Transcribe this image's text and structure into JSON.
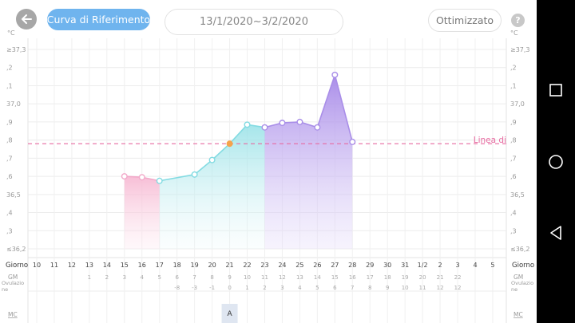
{
  "header": {
    "back_icon": "arrow-left-icon",
    "curve_button_label": "Curva di Riferimento",
    "date_range": "13/1/2020~3/2/2020",
    "optimized_label": "Ottimizzato",
    "help_label": "?"
  },
  "axes": {
    "unit_left": "°C",
    "unit_right": "°C",
    "y_labels": [
      "≥37,3",
      ",2",
      ",1",
      "37,0",
      ",9",
      ",8",
      ",7",
      ",6",
      "36,5",
      ",4",
      ",3",
      "≤36,2"
    ]
  },
  "reference_line_label": "Linea di",
  "colors": {
    "pink": "#f2a9c9",
    "teal": "#83dbe2",
    "purple": "#a98ee8",
    "reference": "#e76aa0",
    "ovulation_point": "#f5a34b"
  },
  "chart_data": {
    "type": "line",
    "x_label": "Giorno",
    "ylim": [
      36.2,
      37.3
    ],
    "days": [
      "10",
      "11",
      "12",
      "13",
      "14",
      "15",
      "16",
      "17",
      "18",
      "19",
      "20",
      "21",
      "22",
      "23",
      "24",
      "25",
      "26",
      "27",
      "28",
      "29",
      "30",
      "31",
      "1/2",
      "2",
      "3",
      "4",
      "5"
    ],
    "temperatures": [
      null,
      null,
      null,
      null,
      null,
      36.6,
      36.595,
      36.575,
      null,
      36.61,
      36.69,
      36.78,
      36.885,
      36.87,
      36.895,
      36.9,
      36.87,
      37.16,
      36.79,
      null,
      null,
      null,
      null,
      null,
      null,
      null,
      null
    ],
    "phases": {
      "menstrual_days": [
        "15",
        "16",
        "17"
      ],
      "follicular_days": [
        "17",
        "18",
        "19",
        "20",
        "21",
        "22",
        "23"
      ],
      "luteal_days": [
        "23",
        "24",
        "25",
        "26",
        "27",
        "28"
      ]
    },
    "ovulation_day": "21",
    "reference_line": 36.78,
    "gm_label": "GM",
    "gm_values": [
      "",
      "",
      "",
      "1",
      "2",
      "3",
      "4",
      "5",
      "6",
      "7",
      "8",
      "9",
      "10",
      "11",
      "12",
      "13",
      "14",
      "15",
      "16",
      "17",
      "18",
      "19",
      "20",
      "21",
      "22",
      "",
      ""
    ],
    "ovulation_label": "Ovulazio\nne",
    "ovulation_values": [
      "",
      "",
      "",
      "",
      "",
      "",
      "",
      "",
      "-8",
      "-3",
      "-1",
      "0",
      "1",
      "2",
      "3",
      "4",
      "5",
      "6",
      "7",
      "8",
      "9",
      "10",
      "11",
      "12",
      "12",
      "",
      ""
    ],
    "mc_label": "MC",
    "mc_marker": {
      "day": "21",
      "label": "A"
    }
  }
}
